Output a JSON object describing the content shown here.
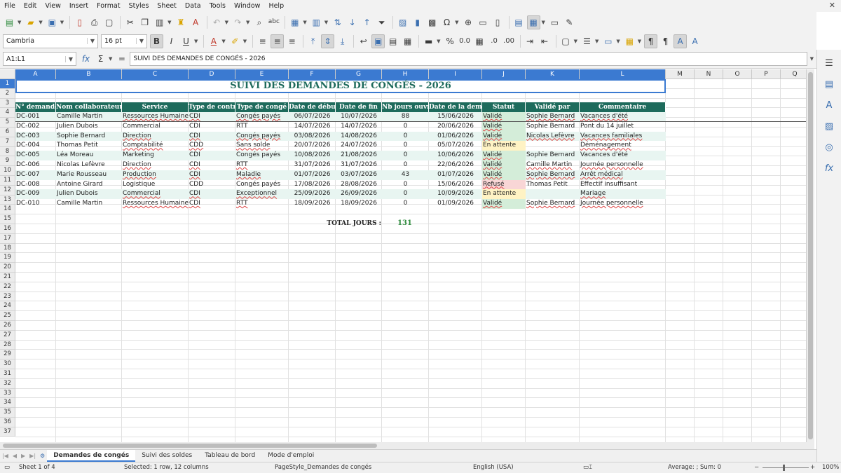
{
  "menu": [
    "File",
    "Edit",
    "View",
    "Insert",
    "Format",
    "Styles",
    "Sheet",
    "Data",
    "Tools",
    "Window",
    "Help"
  ],
  "font": {
    "name": "Cambria",
    "size": "16 pt"
  },
  "formula_bar": {
    "name_box": "A1:L1",
    "content": "SUIVI DES DEMANDES DE CONGÉS - 2026"
  },
  "columns": [
    "A",
    "B",
    "C",
    "D",
    "E",
    "F",
    "G",
    "H",
    "I",
    "J",
    "K",
    "L",
    "M",
    "N",
    "O",
    "P",
    "Q"
  ],
  "rows": [
    "1",
    "2",
    "3",
    "4",
    "5",
    "6",
    "7",
    "8",
    "9",
    "10",
    "11",
    "12",
    "13",
    "14",
    "15",
    "16",
    "17",
    "18",
    "19",
    "20",
    "21",
    "22",
    "23",
    "24",
    "25",
    "26",
    "27",
    "28",
    "29",
    "30",
    "31",
    "32",
    "33",
    "34",
    "35",
    "36",
    "37"
  ],
  "sheet": {
    "title": "SUIVI DES DEMANDES DE CONGÉS - 2026",
    "headers": [
      "N° demande",
      "Nom collaborateur",
      "Service",
      "Type de contrat",
      "Type de congé",
      "Date de début",
      "Date de fin",
      "Nb jours ouvrés",
      "Date de la demande",
      "Statut",
      "Validé par",
      "Commentaire"
    ],
    "rows": [
      [
        "DC-001",
        "Camille Martin",
        "Ressources Humaines",
        "CDI",
        "Congés payés",
        "06/07/2026",
        "10/07/2026",
        "88",
        "15/06/2026",
        "Validé",
        "Sophie Bernard",
        "Vacances d'été"
      ],
      [
        "DC-002",
        "Julien Dubois",
        "Commercial",
        "CDI",
        "RTT",
        "14/07/2026",
        "14/07/2026",
        "0",
        "20/06/2026",
        "Validé",
        "Sophie Bernard",
        "Pont du 14 juillet"
      ],
      [
        "DC-003",
        "Sophie Bernard",
        "Direction",
        "CDI",
        "Congés payés",
        "03/08/2026",
        "14/08/2026",
        "0",
        "01/06/2026",
        "Validé",
        "Nicolas Lefèvre",
        "Vacances familiales"
      ],
      [
        "DC-004",
        "Thomas Petit",
        "Comptabilité",
        "CDD",
        "Sans solde",
        "20/07/2026",
        "24/07/2026",
        "0",
        "05/07/2026",
        "En attente",
        "",
        "Déménagement"
      ],
      [
        "DC-005",
        "Léa Moreau",
        "Marketing",
        "CDI",
        "Congés payés",
        "10/08/2026",
        "21/08/2026",
        "0",
        "10/06/2026",
        "Validé",
        "Sophie Bernard",
        "Vacances d'été"
      ],
      [
        "DC-006",
        "Nicolas Lefèvre",
        "Direction",
        "CDI",
        "RTT",
        "31/07/2026",
        "31/07/2026",
        "0",
        "22/06/2026",
        "Validé",
        "Camille Martin",
        "Journée personnelle"
      ],
      [
        "DC-007",
        "Marie Rousseau",
        "Production",
        "CDI",
        "Maladie",
        "01/07/2026",
        "03/07/2026",
        "43",
        "01/07/2026",
        "Validé",
        "Sophie Bernard",
        "Arrêt médical"
      ],
      [
        "DC-008",
        "Antoine Girard",
        "Logistique",
        "CDD",
        "Congés payés",
        "17/08/2026",
        "28/08/2026",
        "0",
        "15/06/2026",
        "Refusé",
        "Thomas Petit",
        "Effectif insuffisant"
      ],
      [
        "DC-009",
        "Julien Dubois",
        "Commercial",
        "CDI",
        "Exceptionnel",
        "25/09/2026",
        "26/09/2026",
        "0",
        "10/09/2026",
        "En attente",
        "",
        "Mariage"
      ],
      [
        "DC-010",
        "Camille Martin",
        "Ressources Humaines",
        "CDI",
        "RTT",
        "18/09/2026",
        "18/09/2026",
        "0",
        "01/09/2026",
        "Validé",
        "Sophie Bernard",
        "Journée personnelle"
      ]
    ],
    "total_label": "TOTAL JOURS :",
    "total_value": "131"
  },
  "tabs": [
    "Demandes de congés",
    "Suivi des soldes",
    "Tableau de bord",
    "Mode d'emploi"
  ],
  "status": {
    "sheet": "Sheet 1 of 4",
    "selection": "Selected: 1 row, 12 columns",
    "page_style": "PageStyle_Demandes de congés",
    "language": "English (USA)",
    "summary": "Average: ; Sum: 0",
    "zoom": "100%"
  },
  "colors": {
    "header_green": "#1e6b5c",
    "selection_blue": "#3b7ad1",
    "valid_bg": "#d4edd9",
    "pending_bg": "#fff3c4",
    "refused_bg": "#f9d6d6"
  }
}
